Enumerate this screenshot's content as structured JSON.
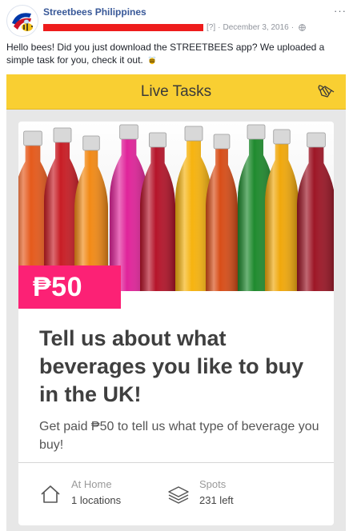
{
  "post": {
    "page_name": "Streetbees Philippines",
    "help_marker": "[?]",
    "date": "December 3, 2016",
    "separator": "·",
    "more_label": "···",
    "text": "Hello bees! Did you just download the STREETBEES app? We uploaded a simple task for you, check it out.",
    "globe_icon": "globe-icon",
    "bee_emoji_icon": "bee-icon"
  },
  "app": {
    "header_title": "Live Tasks",
    "header_color": "#f9cf32",
    "header_icon": "bee-outline-icon",
    "task": {
      "price": "₱50",
      "price_color": "#fc2175",
      "title": "Tell us about what beverages you like to buy in the UK!",
      "description": "Get paid ₱50 to tell us what type of beverage you buy!",
      "image": "soda-bottles-photo",
      "location_label": "At Home",
      "location_value": "1 locations",
      "location_icon": "house-icon",
      "spots_label": "Spots",
      "spots_value": "231 left",
      "spots_icon": "stack-icon"
    }
  }
}
